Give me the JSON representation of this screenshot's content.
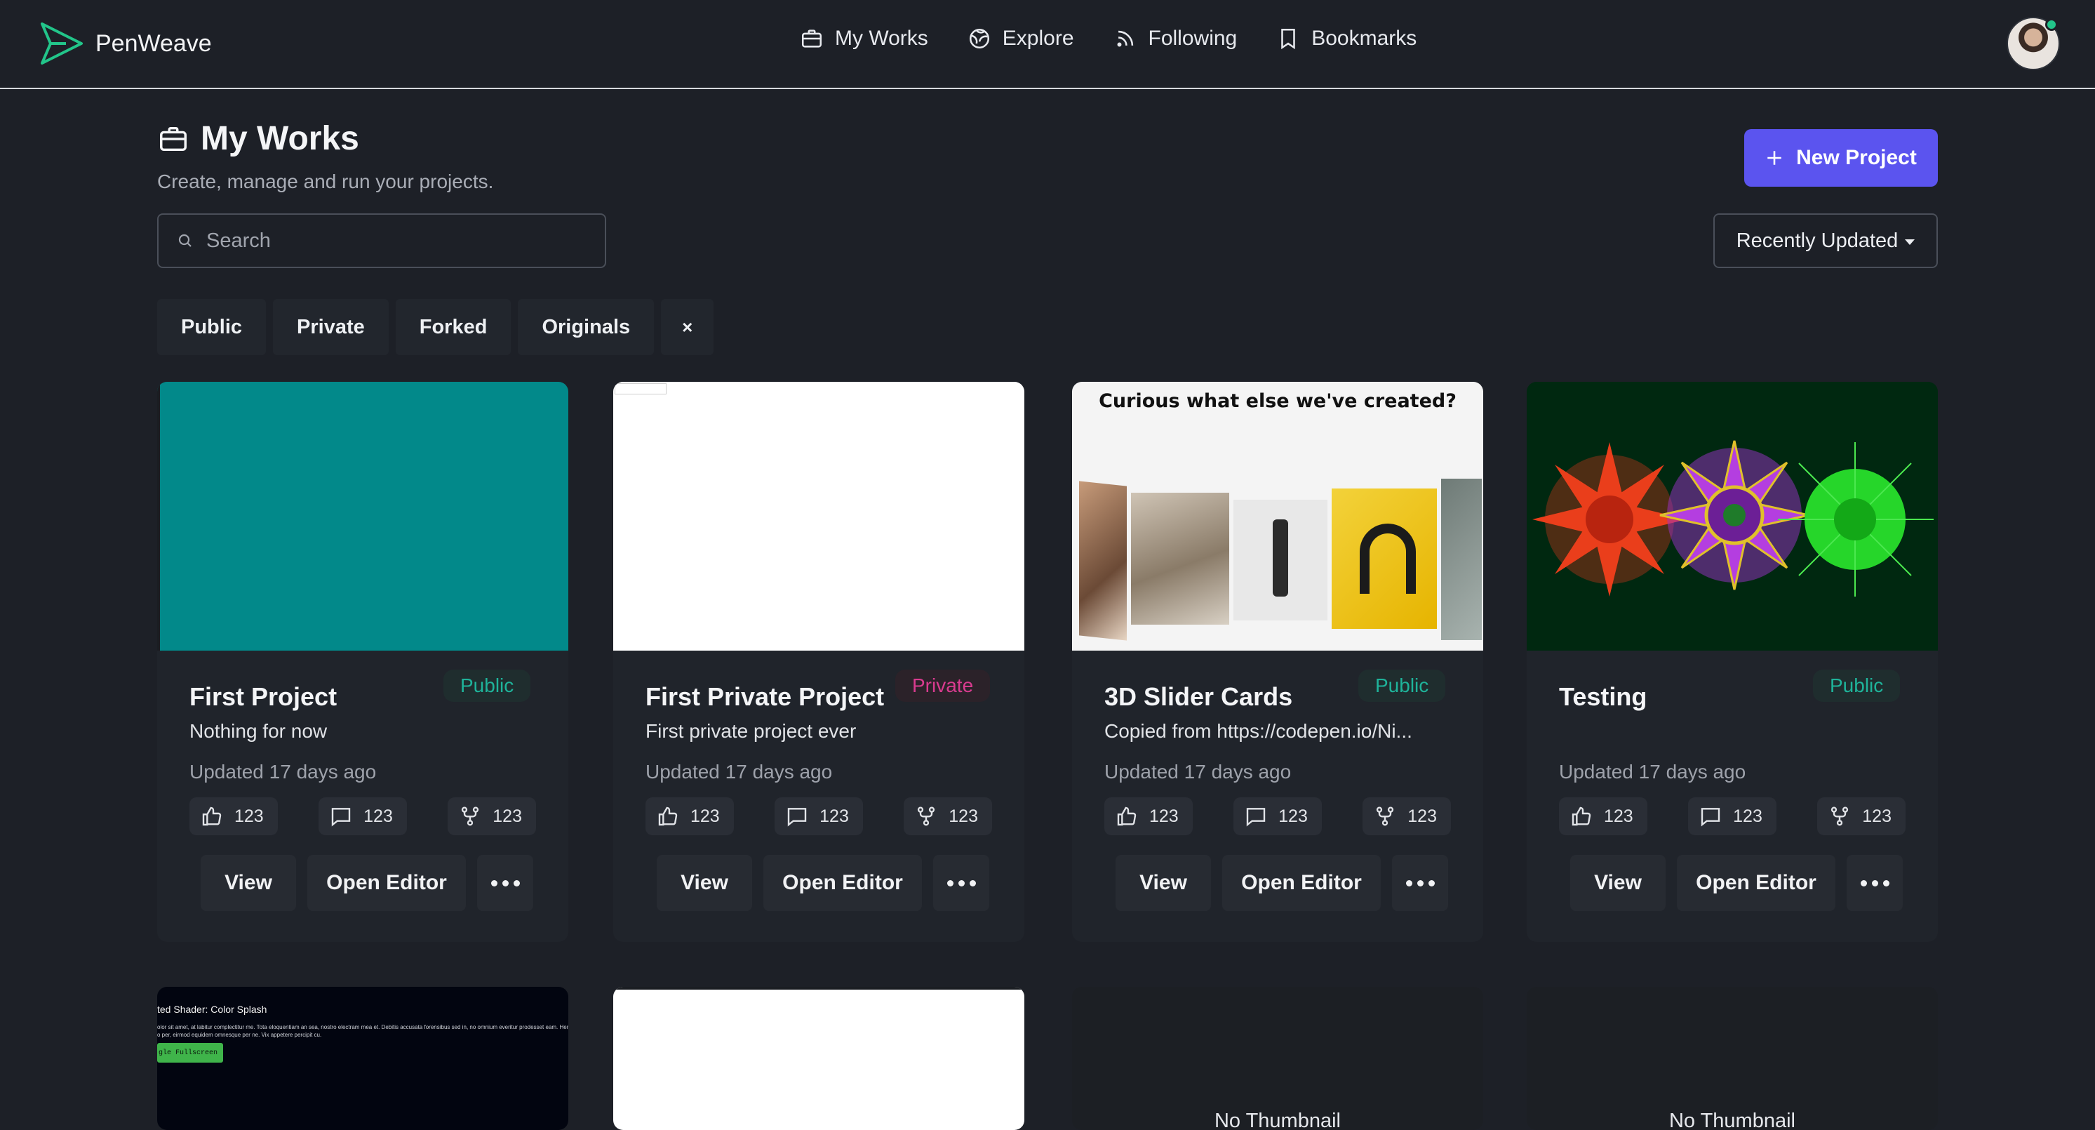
{
  "brand": {
    "name": "PenWeave",
    "accent": "#22c58a"
  },
  "nav": {
    "links": [
      {
        "label": "My Works",
        "icon": "briefcase-icon"
      },
      {
        "label": "Explore",
        "icon": "globe-icon"
      },
      {
        "label": "Following",
        "icon": "rss-icon"
      },
      {
        "label": "Bookmarks",
        "icon": "bookmark-icon"
      }
    ]
  },
  "page": {
    "title": "My Works",
    "subtitle": "Create, manage and run your projects.",
    "new_project_label": "New Project",
    "new_project_color": "#5b54ef"
  },
  "search": {
    "placeholder": "Search",
    "value": ""
  },
  "sort": {
    "selected": "Recently Updated"
  },
  "filters": [
    "Public",
    "Private",
    "Forked",
    "Originals",
    "×"
  ],
  "cards": [
    {
      "title": "First Project",
      "visibility": "Public",
      "description": "Nothing for now",
      "updated": "Updated 17 days ago",
      "likes": "123",
      "comments": "123",
      "forks": "123",
      "thumb_color": "#02898a"
    },
    {
      "title": "First Private Project",
      "visibility": "Private",
      "description": "First private project ever",
      "updated": "Updated 17 days ago",
      "likes": "123",
      "comments": "123",
      "forks": "123",
      "thumb_color": "#ffffff"
    },
    {
      "title": "3D Slider Cards",
      "visibility": "Public",
      "description": "Copied from https://codepen.io/Ni...",
      "updated": "Updated 17 days ago",
      "likes": "123",
      "comments": "123",
      "forks": "123",
      "thumb_heading": "Curious what else we've created?"
    },
    {
      "title": "Testing",
      "visibility": "Public",
      "description": "",
      "updated": "Updated 17 days ago",
      "likes": "123",
      "comments": "123",
      "forks": "123",
      "thumb_color": "#002810"
    }
  ],
  "card_actions": {
    "view": "View",
    "edit": "Open Editor"
  },
  "row2": {
    "shader_title": "ted Shader: Color Splash",
    "shader_body": "olor sit amet, at labitur complectitur me. Tota eloquentiam an sea, nostro electram mea et. Debitis accusata forensibus sed in, no omnium everitur prodesset eam. Hendrerit",
    "shader_body2": "o per, eirmod equidem omnesque per ne. Vix appetere percipit cu.",
    "shader_button": "gle Fullscreen",
    "no_thumbnail": "No Thumbnail"
  }
}
